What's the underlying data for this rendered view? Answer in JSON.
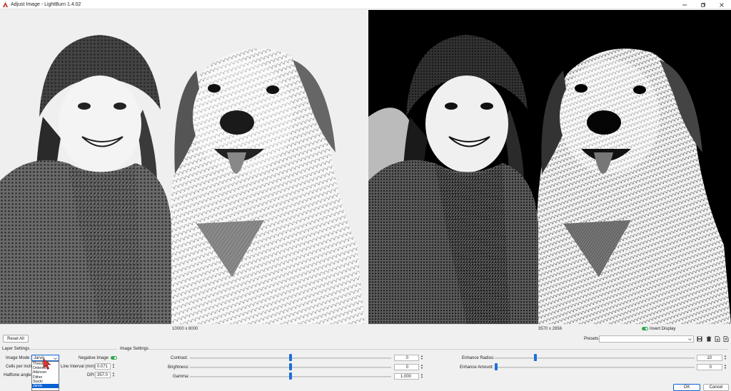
{
  "window": {
    "title": "Adjust Image - LightBurn 1.4.02"
  },
  "previews": {
    "left_dimensions": "10000 x 8000",
    "right_dimensions": "3570 x 2856",
    "invert_display_label": "Invert Display",
    "invert_display_on": true
  },
  "toolbar": {
    "reset_all_label": "Reset All",
    "presets_label": "Presets:",
    "presets_value": ""
  },
  "layer_settings": {
    "group_label": "Layer Settings",
    "image_mode_label": "Image Mode:",
    "image_mode_value": "Jarvis",
    "image_mode_options": [
      "Threshold",
      "Ordered",
      "Atkinson",
      "Dither",
      "Stucki",
      "Jarvis"
    ],
    "cells_per_inch_label": "Cells per inch",
    "halftone_angle_label": "Halftone angle",
    "negative_image_label": "Negative Image",
    "negative_image_on": true,
    "line_interval_label": "Line Interval (mm)",
    "line_interval_value": "0.071",
    "dpi_label": "DPI",
    "dpi_value": "357.0"
  },
  "image_settings": {
    "group_label": "Image Settings",
    "contrast_label": "Contrast:",
    "contrast_value": "0",
    "contrast_level": 0.5,
    "brightness_label": "Brightness:",
    "brightness_value": "0",
    "brightness_level": 0.5,
    "gamma_label": "Gamma:",
    "gamma_value": "1.000",
    "gamma_level": 0.5,
    "enhance_radius_label": "Enhance Radius:",
    "enhance_radius_value": "10",
    "enhance_radius_level": 0.2,
    "enhance_amount_label": "Enhance Amount:",
    "enhance_amount_value": "0",
    "enhance_amount_level": 0.0
  },
  "footer": {
    "ok_label": "OK",
    "cancel_label": "Cancel"
  },
  "colors": {
    "accent": "#1e6fd9",
    "toggle_on": "#2fa84f",
    "selection": "#0b61d3",
    "app_icon": "#c0392b"
  }
}
